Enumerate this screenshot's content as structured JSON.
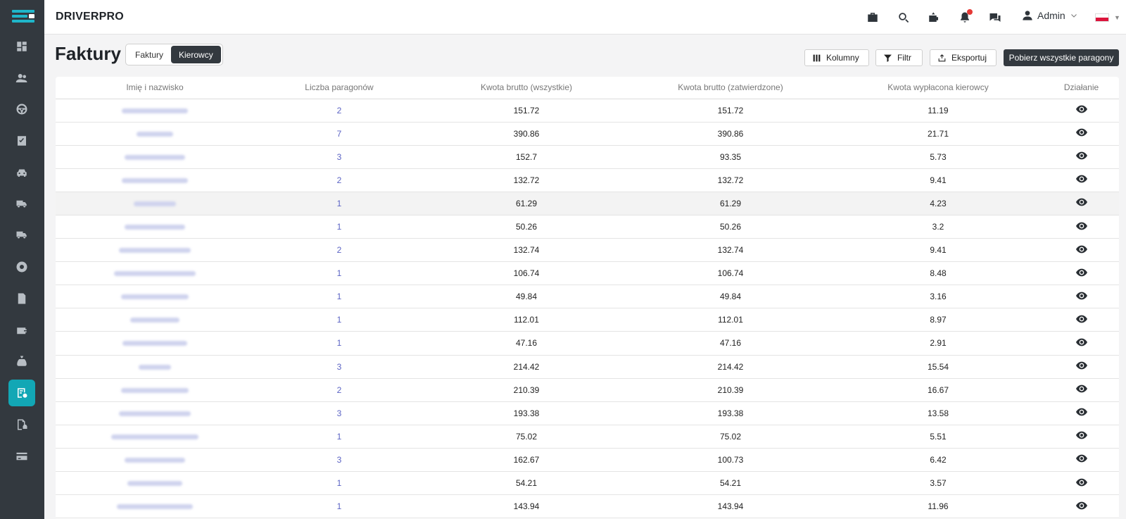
{
  "app": {
    "brand": "DRIVERPRO"
  },
  "user": {
    "name": "Admin"
  },
  "page": {
    "title": "Faktury"
  },
  "segments": [
    {
      "label": "Faktury",
      "active": false
    },
    {
      "label": "Kierowcy",
      "active": true
    }
  ],
  "toolbar": {
    "columns_label": "Kolumny",
    "filter_label": "Filtr",
    "export_label": "Eksportuj",
    "download_all_label": "Pobierz wszystkie paragony"
  },
  "table": {
    "headers": [
      "Imię i nazwisko",
      "Liczba paragonów",
      "Kwota brutto (wszystkie)",
      "Kwota brutto (zatwierdzone)",
      "Kwota wypłacona kierowcy",
      "Działanie"
    ],
    "rows": [
      {
        "count": "2",
        "gross_all": "151.72",
        "gross_approved": "151.72",
        "paid": "11.19"
      },
      {
        "count": "7",
        "gross_all": "390.86",
        "gross_approved": "390.86",
        "paid": "21.71"
      },
      {
        "count": "3",
        "gross_all": "152.7",
        "gross_approved": "93.35",
        "paid": "5.73"
      },
      {
        "count": "2",
        "gross_all": "132.72",
        "gross_approved": "132.72",
        "paid": "9.41"
      },
      {
        "count": "1",
        "gross_all": "61.29",
        "gross_approved": "61.29",
        "paid": "4.23"
      },
      {
        "count": "1",
        "gross_all": "50.26",
        "gross_approved": "50.26",
        "paid": "3.2"
      },
      {
        "count": "2",
        "gross_all": "132.74",
        "gross_approved": "132.74",
        "paid": "9.41"
      },
      {
        "count": "1",
        "gross_all": "106.74",
        "gross_approved": "106.74",
        "paid": "8.48"
      },
      {
        "count": "1",
        "gross_all": "49.84",
        "gross_approved": "49.84",
        "paid": "3.16"
      },
      {
        "count": "1",
        "gross_all": "112.01",
        "gross_approved": "112.01",
        "paid": "8.97"
      },
      {
        "count": "1",
        "gross_all": "47.16",
        "gross_approved": "47.16",
        "paid": "2.91"
      },
      {
        "count": "3",
        "gross_all": "214.42",
        "gross_approved": "214.42",
        "paid": "15.54"
      },
      {
        "count": "2",
        "gross_all": "210.39",
        "gross_approved": "210.39",
        "paid": "16.67"
      },
      {
        "count": "3",
        "gross_all": "193.38",
        "gross_approved": "193.38",
        "paid": "13.58"
      },
      {
        "count": "1",
        "gross_all": "75.02",
        "gross_approved": "75.02",
        "paid": "5.51"
      },
      {
        "count": "3",
        "gross_all": "162.67",
        "gross_approved": "100.73",
        "paid": "6.42"
      },
      {
        "count": "1",
        "gross_all": "54.21",
        "gross_approved": "54.21",
        "paid": "3.57"
      },
      {
        "count": "1",
        "gross_all": "143.94",
        "gross_approved": "143.94",
        "paid": "11.96"
      }
    ]
  },
  "icons": {
    "sidebar": [
      "dashboard-icon",
      "users-icon",
      "steering-wheel-icon",
      "tasks-icon",
      "car-icon",
      "truck-icon",
      "truck-icon",
      "tire-icon",
      "document-icon",
      "wallet-icon",
      "money-bag-icon",
      "receipt-icon",
      "vehicle-document-icon",
      "credit-card-icon"
    ],
    "topbar": [
      "briefcase-icon",
      "search-icon",
      "wallet-alert-icon",
      "bell-icon",
      "chat-icon",
      "user-icon",
      "chevron-down-icon",
      "flag-pl-icon"
    ],
    "row_action": "eye-icon"
  },
  "colors": {
    "sidebar": "#33393f",
    "accent": "#12a7b5",
    "count_link": "#5b63c4",
    "notification": "#e53935"
  }
}
